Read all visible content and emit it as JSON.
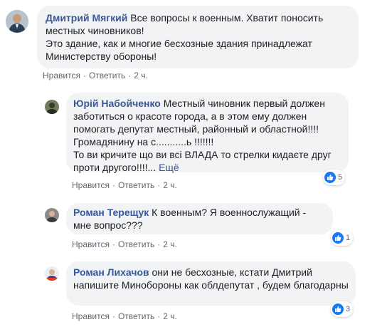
{
  "comments": [
    {
      "author": "Дмитрий Мягкий",
      "text": "Все вопросы к военным. Хватит поносить местных чиновников!\nЭто здание, как и многие бесхозные здания принадлежат Министерству обороны!",
      "like": "Нравится",
      "reply": "Ответить",
      "time": "2 ч."
    },
    {
      "author": "Юрій Набойченко",
      "text": "Местный чиновник первый должен заботиться о красоте города, а в этом ему должен помогать депутат местный, районный и областной!!!! Громадянину на с...........ь !!!!!!!\nТо ви кричите що ви всі ВЛАДА то стрелки кидаєте друг проти другого!!!!...",
      "more": "Ещё",
      "like": "Нравится",
      "reply": "Ответить",
      "time": "2 ч.",
      "reactions": "5"
    },
    {
      "author": "Роман Терещук",
      "text": "К военным? Я военнослужащий - мне вопрос???",
      "like": "Нравится",
      "reply": "Ответить",
      "time": "2 ч.",
      "reactions": "1"
    },
    {
      "author": "Роман Лихачов",
      "text": "они не бесхозные, кстати Дмитрий напишите Минобороны как облдепутат , будем благодарны",
      "like": "Нравится",
      "reply": "Ответить",
      "time": "2 ч.",
      "reactions": "3"
    }
  ],
  "colors": {
    "author": "#385898",
    "bubble": "#f2f3f5",
    "meta": "#606770",
    "like_badge": "#1877f2"
  }
}
